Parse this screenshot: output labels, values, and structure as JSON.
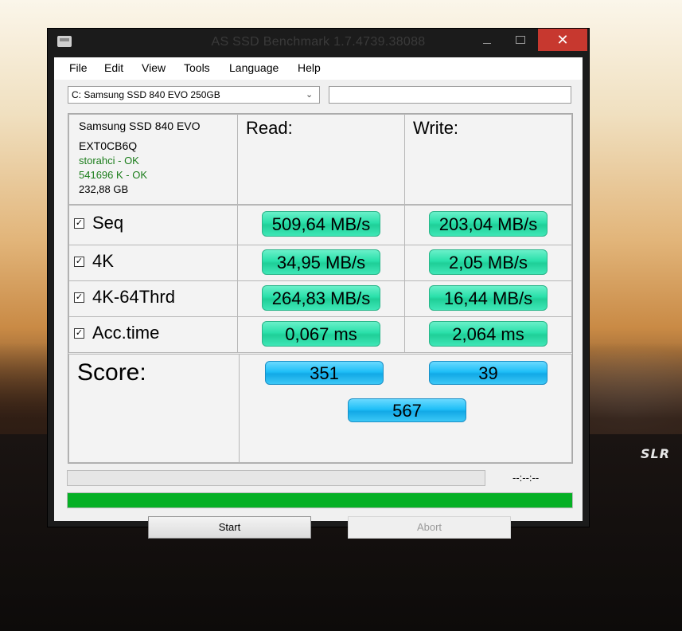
{
  "window": {
    "title": "AS SSD Benchmark 1.7.4739.38088",
    "close_label": "✕"
  },
  "menu": [
    "File",
    "Edit",
    "View",
    "Tools",
    "Language",
    "Help"
  ],
  "drive_select": {
    "value": "C: Samsung SSD 840 EVO 250GB",
    "chevron": "⌄"
  },
  "extra_field": {
    "value": ""
  },
  "info": {
    "model": "Samsung SSD 840 EVO",
    "firmware": "EXT0CB6Q",
    "driver": "storahci - OK",
    "alignment": "541696 K - OK",
    "capacity": "232,88 GB"
  },
  "headers": {
    "read": "Read:",
    "write": "Write:"
  },
  "tests": [
    {
      "label": "Seq",
      "checked": true,
      "read": "509,64 MB/s",
      "write": "203,04 MB/s"
    },
    {
      "label": "4K",
      "checked": true,
      "read": "34,95 MB/s",
      "write": "2,05 MB/s"
    },
    {
      "label": "4K-64Thrd",
      "checked": true,
      "read": "264,83 MB/s",
      "write": "16,44 MB/s"
    },
    {
      "label": "Acc.time",
      "checked": true,
      "read": "0,067 ms",
      "write": "2,064 ms"
    }
  ],
  "check_mark": "✓",
  "score": {
    "label": "Score:",
    "read": "351",
    "write": "39",
    "total": "567"
  },
  "progress": {
    "time": "--:--:--",
    "current_fraction": 0,
    "overall_fraction": 1
  },
  "buttons": {
    "start": "Start",
    "abort": "Abort"
  },
  "colors": {
    "green_pill": "#2ae0aa",
    "blue_pill": "#1fbff7",
    "progress_fill": "#06b025",
    "close_button": "#c7382f"
  },
  "background": {
    "badge": "SLR"
  }
}
